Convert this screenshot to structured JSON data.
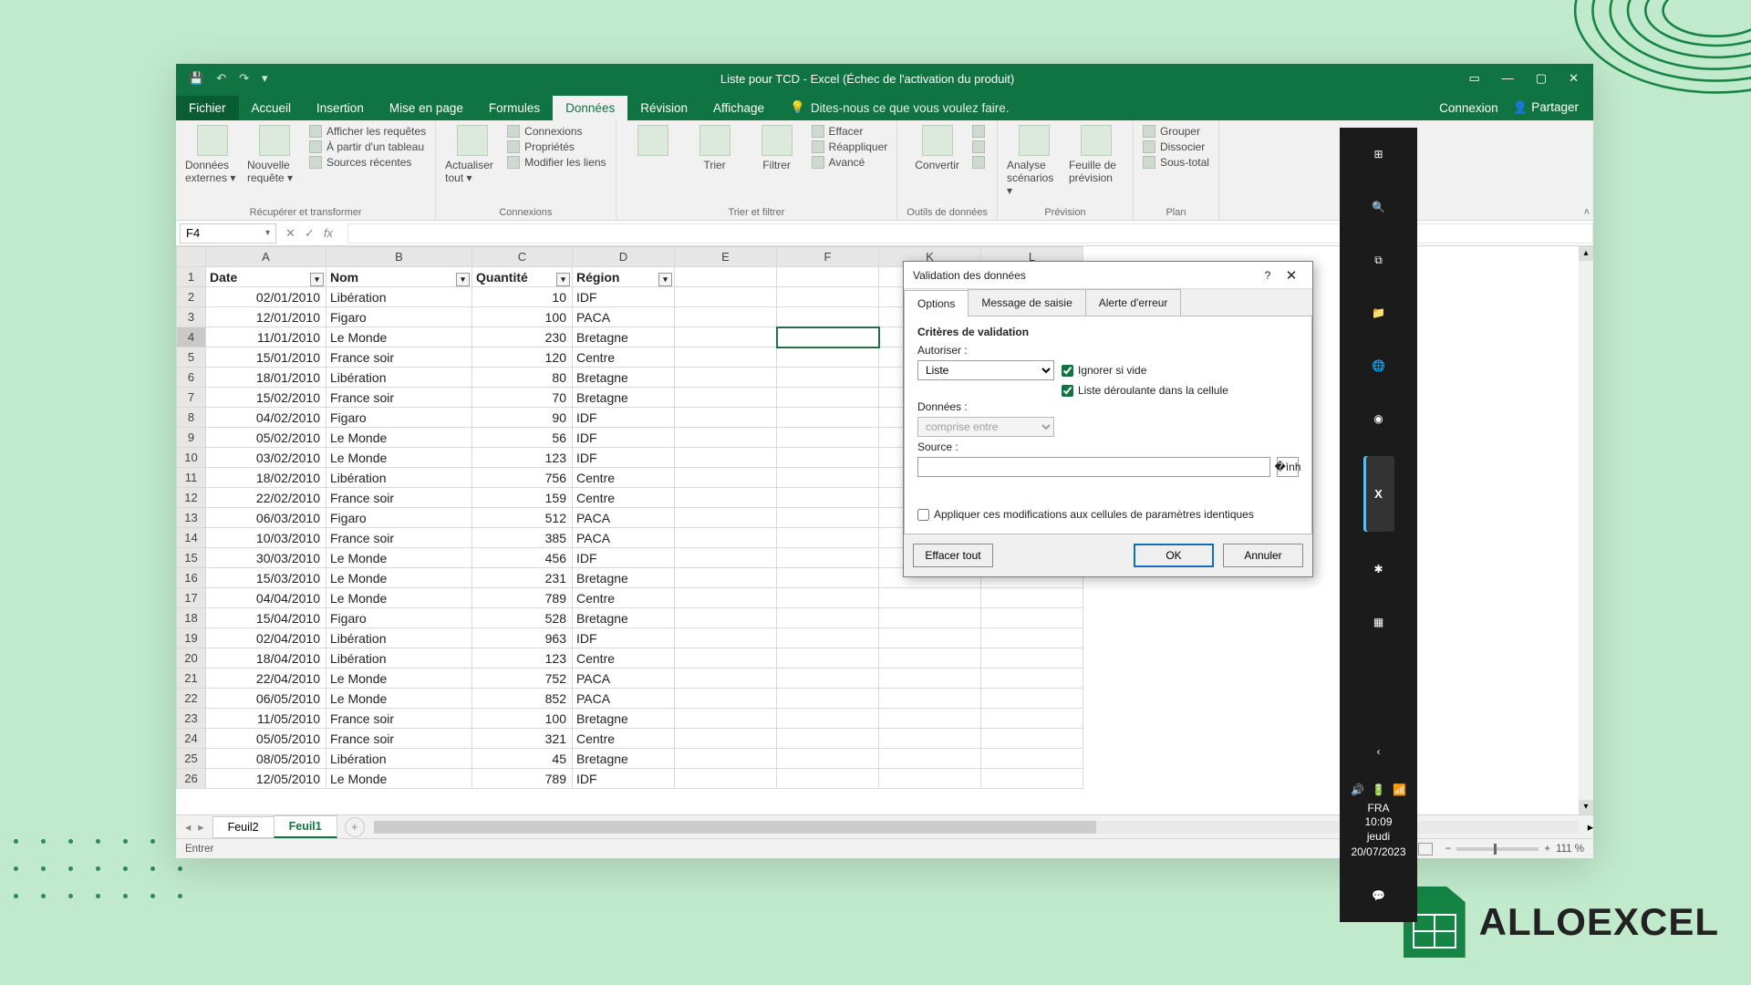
{
  "brand": "ALLOEXCEL",
  "titlebar": {
    "title": "Liste pour TCD - Excel (Échec de l'activation du produit)"
  },
  "tabs": {
    "file": "Fichier",
    "home": "Accueil",
    "insert": "Insertion",
    "layout": "Mise en page",
    "formulas": "Formules",
    "data": "Données",
    "review": "Révision",
    "view": "Affichage",
    "tell": "Dites-nous ce que vous voulez faire.",
    "connexion": "Connexion",
    "share": "Partager"
  },
  "ribbon": {
    "g1": {
      "btn1": "Données externes ▾",
      "btn2": "Nouvelle requête ▾",
      "i1": "Afficher les requêtes",
      "i2": "À partir d'un tableau",
      "i3": "Sources récentes",
      "label": "Récupérer et transformer"
    },
    "g2": {
      "btn": "Actualiser tout ▾",
      "i1": "Connexions",
      "i2": "Propriétés",
      "i3": "Modifier les liens",
      "label": "Connexions"
    },
    "g3": {
      "sort": "Trier",
      "filter": "Filtrer",
      "i1": "Effacer",
      "i2": "Réappliquer",
      "i3": "Avancé",
      "label": "Trier et filtrer"
    },
    "g4": {
      "btn": "Convertir",
      "label": "Outils de données"
    },
    "g5": {
      "b1": "Analyse scénarios ▾",
      "b2": "Feuille de prévision",
      "label": "Prévision"
    },
    "g6": {
      "i1": "Grouper",
      "i2": "Dissocier",
      "i3": "Sous-total",
      "label": "Plan"
    }
  },
  "fbar": {
    "name": "F4"
  },
  "columns": [
    "A",
    "B",
    "C",
    "D",
    "E",
    "F",
    "K",
    "L"
  ],
  "headers": {
    "A": "Date",
    "B": "Nom",
    "C": "Quantité",
    "D": "Région"
  },
  "rows": [
    {
      "n": 1,
      "A": "",
      "B": "",
      "C": "",
      "D": ""
    },
    {
      "n": 2,
      "A": "02/01/2010",
      "B": "Libération",
      "C": "10",
      "D": "IDF"
    },
    {
      "n": 3,
      "A": "12/01/2010",
      "B": "Figaro",
      "C": "100",
      "D": "PACA"
    },
    {
      "n": 4,
      "A": "11/01/2010",
      "B": "Le Monde",
      "C": "230",
      "D": "Bretagne"
    },
    {
      "n": 5,
      "A": "15/01/2010",
      "B": "France soir",
      "C": "120",
      "D": "Centre"
    },
    {
      "n": 6,
      "A": "18/01/2010",
      "B": "Libération",
      "C": "80",
      "D": "Bretagne"
    },
    {
      "n": 7,
      "A": "15/02/2010",
      "B": "France soir",
      "C": "70",
      "D": "Bretagne"
    },
    {
      "n": 8,
      "A": "04/02/2010",
      "B": "Figaro",
      "C": "90",
      "D": "IDF"
    },
    {
      "n": 9,
      "A": "05/02/2010",
      "B": "Le Monde",
      "C": "56",
      "D": "IDF"
    },
    {
      "n": 10,
      "A": "03/02/2010",
      "B": "Le Monde",
      "C": "123",
      "D": "IDF"
    },
    {
      "n": 11,
      "A": "18/02/2010",
      "B": "Libération",
      "C": "756",
      "D": "Centre"
    },
    {
      "n": 12,
      "A": "22/02/2010",
      "B": "France soir",
      "C": "159",
      "D": "Centre"
    },
    {
      "n": 13,
      "A": "06/03/2010",
      "B": "Figaro",
      "C": "512",
      "D": "PACA"
    },
    {
      "n": 14,
      "A": "10/03/2010",
      "B": "France soir",
      "C": "385",
      "D": "PACA"
    },
    {
      "n": 15,
      "A": "30/03/2010",
      "B": "Le Monde",
      "C": "456",
      "D": "IDF"
    },
    {
      "n": 16,
      "A": "15/03/2010",
      "B": "Le Monde",
      "C": "231",
      "D": "Bretagne"
    },
    {
      "n": 17,
      "A": "04/04/2010",
      "B": "Le Monde",
      "C": "789",
      "D": "Centre"
    },
    {
      "n": 18,
      "A": "15/04/2010",
      "B": "Figaro",
      "C": "528",
      "D": "Bretagne"
    },
    {
      "n": 19,
      "A": "02/04/2010",
      "B": "Libération",
      "C": "963",
      "D": "IDF"
    },
    {
      "n": 20,
      "A": "18/04/2010",
      "B": "Libération",
      "C": "123",
      "D": "Centre"
    },
    {
      "n": 21,
      "A": "22/04/2010",
      "B": "Le Monde",
      "C": "752",
      "D": "PACA"
    },
    {
      "n": 22,
      "A": "06/05/2010",
      "B": "Le Monde",
      "C": "852",
      "D": "PACA"
    },
    {
      "n": 23,
      "A": "11/05/2010",
      "B": "France soir",
      "C": "100",
      "D": "Bretagne"
    },
    {
      "n": 24,
      "A": "05/05/2010",
      "B": "France soir",
      "C": "321",
      "D": "Centre"
    },
    {
      "n": 25,
      "A": "08/05/2010",
      "B": "Libération",
      "C": "45",
      "D": "Bretagne"
    },
    {
      "n": 26,
      "A": "12/05/2010",
      "B": "Le Monde",
      "C": "789",
      "D": "IDF"
    }
  ],
  "sheets": {
    "s1": "Feuil2",
    "s2": "Feuil1"
  },
  "status": {
    "mode": "Entrer",
    "zoom": "111 %"
  },
  "dialog": {
    "title": "Validation des données",
    "tab1": "Options",
    "tab2": "Message de saisie",
    "tab3": "Alerte d'erreur",
    "section": "Critères de validation",
    "allow_lbl": "Autoriser :",
    "allow_val": "Liste",
    "ignore": "Ignorer si vide",
    "incell": "Liste déroulante dans la cellule",
    "data_lbl": "Données :",
    "data_val": "comprise entre",
    "source_lbl": "Source :",
    "apply": "Appliquer ces modifications aux cellules de paramètres identiques",
    "clear": "Effacer tout",
    "ok": "OK",
    "cancel": "Annuler"
  },
  "win": {
    "lang": "FRA",
    "time": "10:09",
    "day": "jeudi",
    "date": "20/07/2023"
  }
}
